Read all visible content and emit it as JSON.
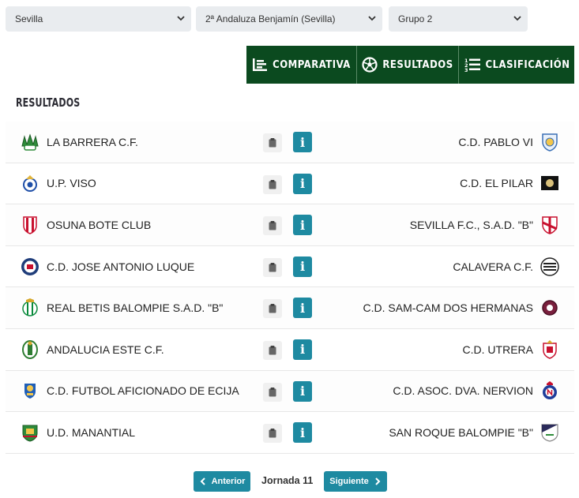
{
  "filters": {
    "province": "Sevilla",
    "competition": "2ª Andaluza Benjamín (Sevilla)",
    "group": "Grupo 2"
  },
  "tabs": {
    "comparativa": "COMPARATIVA",
    "resultados": "RESULTADOS",
    "clasificacion": "CLASIFICACIÓN"
  },
  "section_title": "RESULTADOS",
  "matches": [
    {
      "home": "LA BARRERA C.F.",
      "away": "C.D. PABLO VI"
    },
    {
      "home": "U.P. VISO",
      "away": "C.D. EL PILAR"
    },
    {
      "home": "OSUNA BOTE CLUB",
      "away": "SEVILLA F.C., S.A.D. \"B\""
    },
    {
      "home": "C.D. JOSE ANTONIO LUQUE",
      "away": "CALAVERA C.F."
    },
    {
      "home": "REAL BETIS BALOMPIE S.A.D. \"B\"",
      "away": "C.D. SAM-CAM DOS HERMANAS"
    },
    {
      "home": "ANDALUCIA ESTE C.F.",
      "away": "C.D. UTRERA"
    },
    {
      "home": "C.D. FUTBOL AFICIONADO DE ECIJA",
      "away": "C.D. ASOC. DVA. NERVION"
    },
    {
      "home": "U.D. MANANTIAL",
      "away": "SAN ROQUE BALOMPIE \"B\""
    }
  ],
  "info_label": "i",
  "pager": {
    "prev": "Anterior",
    "current": "Jornada 11",
    "next": "Siguiente"
  },
  "colors": {
    "tab_bg": "#0b4a1f",
    "button_teal": "#1e8aa1"
  }
}
